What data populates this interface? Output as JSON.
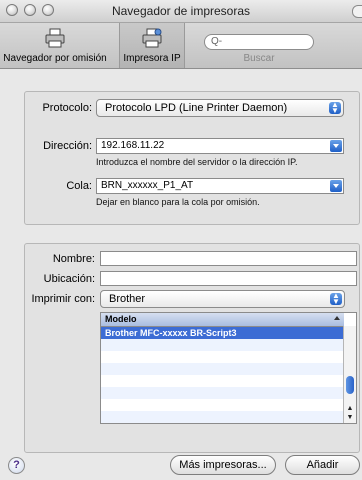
{
  "window": {
    "title": "Navegador de impresoras"
  },
  "toolbar": {
    "default_browser": "Navegador por omisión",
    "ip_printer": "Impresora IP",
    "search_label": "Buscar",
    "search_placeholder": "Q-"
  },
  "connection": {
    "protocol_label": "Protocolo:",
    "protocol_value": "Protocolo LPD (Line Printer Daemon)",
    "address_label": "Dirección:",
    "address_value": "192.168.11.22",
    "address_hint": "Introduzca el nombre del servidor o la dirección IP.",
    "queue_label": "Cola:",
    "queue_value": "BRN_xxxxxx_P1_AT",
    "queue_hint": "Dejar en blanco para la cola por omisión."
  },
  "details": {
    "name_label": "Nombre:",
    "name_value": "",
    "location_label": "Ubicación:",
    "location_value": "",
    "print_using_label": "Imprimir con:",
    "print_using_value": "Brother",
    "model_header": "Modelo",
    "models": [
      "Brother MFC-xxxxx BR-Script3"
    ]
  },
  "buttons": {
    "help": "?",
    "more_printers": "Más impresoras...",
    "add": "Añadir"
  }
}
